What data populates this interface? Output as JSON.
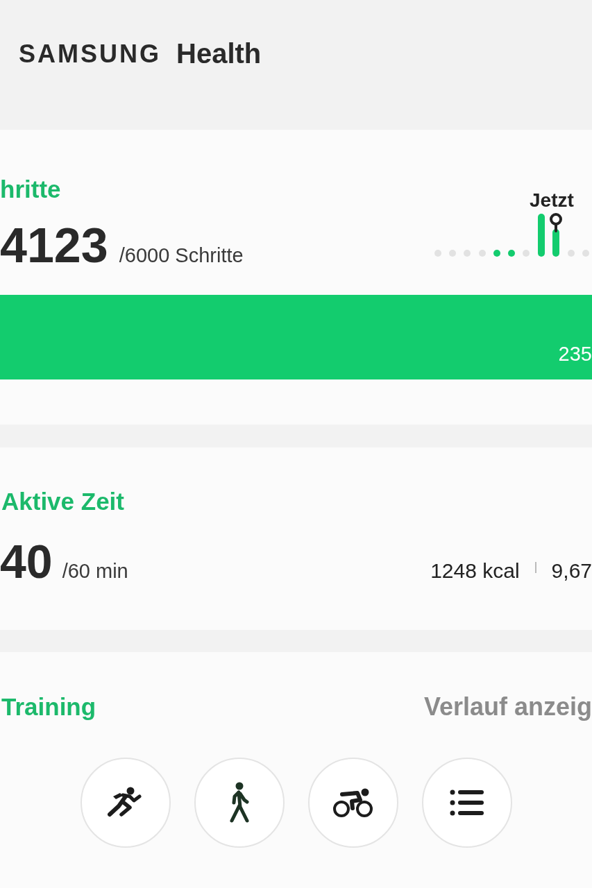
{
  "header": {
    "brand": "SAMSUNG",
    "app": "Health"
  },
  "steps": {
    "title": "hritte",
    "count": "4123",
    "goal": "/6000 Schritte",
    "now_label": "Jetzt",
    "bar_value": "235"
  },
  "active_time": {
    "title": "Aktive Zeit",
    "minutes": "40",
    "goal": "/60 min",
    "calories": "1248 kcal",
    "distance": "9,67"
  },
  "training": {
    "title": "Training",
    "history_link": "Verlauf anzeig",
    "activities": [
      {
        "kind": "run"
      },
      {
        "kind": "walk"
      },
      {
        "kind": "bike"
      },
      {
        "kind": "list"
      }
    ]
  }
}
